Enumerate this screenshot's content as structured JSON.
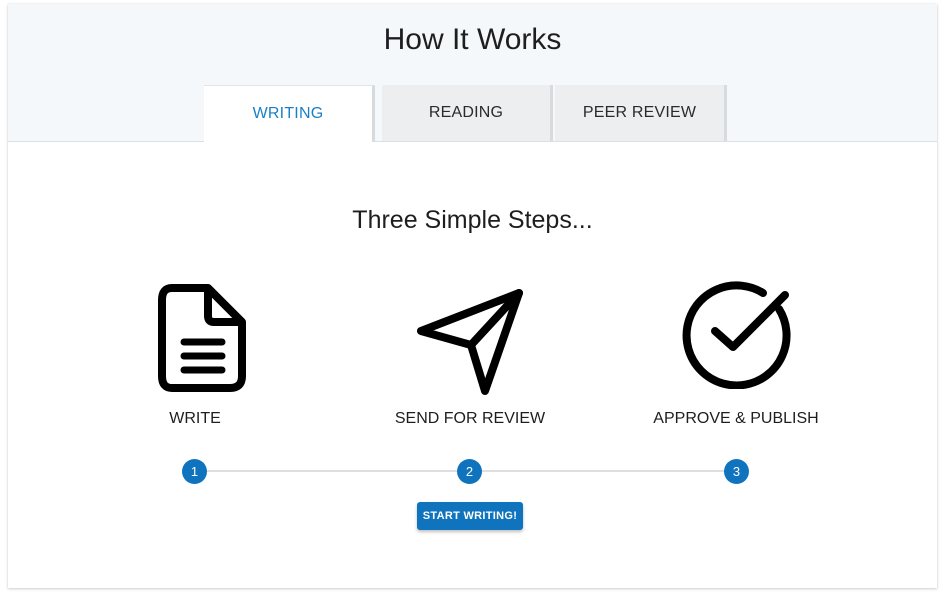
{
  "header": {
    "title": "How It Works"
  },
  "tabs": [
    {
      "label": "WRITING",
      "active": true
    },
    {
      "label": "READING",
      "active": false
    },
    {
      "label": "PEER REVIEW",
      "active": false
    }
  ],
  "content": {
    "subtitle": "Three Simple Steps...",
    "steps": [
      {
        "icon": "document-icon",
        "label": "WRITE",
        "number": "1"
      },
      {
        "icon": "paper-plane-icon",
        "label": "SEND FOR REVIEW",
        "number": "2"
      },
      {
        "icon": "check-circle-icon",
        "label": "APPROVE & PUBLISH",
        "number": "3"
      }
    ],
    "cta_label": "START WRITING!"
  },
  "colors": {
    "accent": "#0f74bd",
    "tab_active_text": "#1a7fc4",
    "header_bg": "#f4f8fb"
  }
}
